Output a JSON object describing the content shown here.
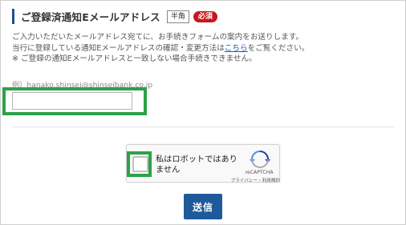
{
  "section": {
    "title": "ご登録済通知Eメールアドレス",
    "badge_hankaku": "半角",
    "badge_required": "必須"
  },
  "description": {
    "line1": "ご入力いただいたメールアドレス宛てに、お手続きフォームの案内をお送りします。",
    "line2_before": "当行に登録している通知Eメールアドレスの確認・変更方法は",
    "line2_link": "こちら",
    "line2_after": "をご覧ください。",
    "line3": "※ ご登録の通知Eメールアドレスと一致しない場合手続きできません。"
  },
  "email": {
    "example": "例）hanako.shinsei@shinseibank.co.jp",
    "value": "",
    "placeholder": ""
  },
  "recaptcha": {
    "label": "私はロボットではありません",
    "brand": "reCAPTCHA",
    "links": "プライバシー・利用規約"
  },
  "submit": {
    "label": "送信"
  },
  "colors": {
    "accent": "#1b4f8f",
    "required": "#c8161d",
    "highlight": "#2ea14a",
    "button": "#1e5a99",
    "link": "#1a57a8"
  }
}
